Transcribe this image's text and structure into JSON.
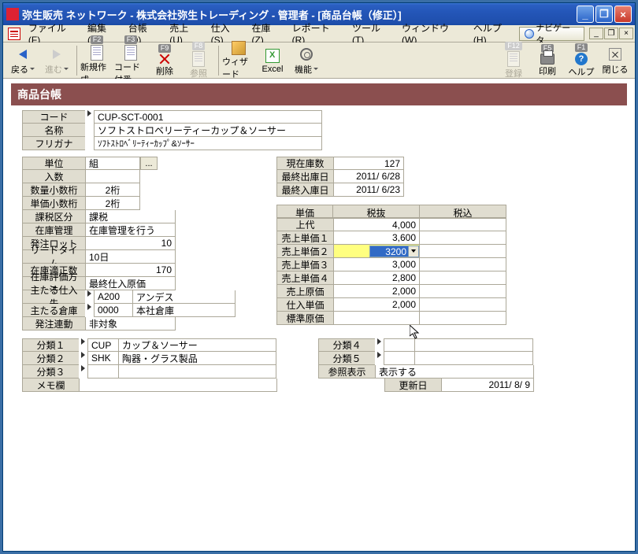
{
  "title": "弥生販売 ネットワーク - 株式会社弥生トレーディング - 管理者 - [商品台帳（修正）]",
  "nav_btn": "ナビゲータ",
  "menu": [
    "ファイル(F)",
    "編集(E)",
    "台帳(D)",
    "売上(U)",
    "仕入(S)",
    "在庫(Z)",
    "レポート(R)",
    "ツール(T)",
    "ウィンドウ(W)",
    "ヘルプ(H)"
  ],
  "tb": {
    "back": "戻る",
    "fwd": "進む",
    "new": "新規作成",
    "code": "コード付番",
    "del": "削除",
    "ref": "参照",
    "wiz": "ウィザード",
    "excel": "Excel",
    "func": "機能",
    "reg": "登録",
    "print": "印刷",
    "help": "ヘルプ",
    "close": "閉じる"
  },
  "header": "商品台帳",
  "main": {
    "code_l": "コード",
    "code_v": "CUP-SCT-0001",
    "name_l": "名称",
    "name_v": "ソフトストロベリーティーカップ＆ソーサー",
    "kana_l": "フリガナ",
    "kana_v": "ｿﾌﾄｽﾄﾛﾍﾞﾘｰﾃｨｰｶｯﾌﾟ&ｿｰｻｰ"
  },
  "left1": {
    "unit_l": "単位",
    "unit_v": "組",
    "qty_l": "入数",
    "qty_v": "",
    "dec1_l": "数量小数桁",
    "dec1_v": "2桁",
    "dec2_l": "単価小数桁",
    "dec2_v": "2桁",
    "tax_l": "課税区分",
    "tax_v": "課税",
    "stock_l": "在庫管理",
    "stock_v": "在庫管理を行う",
    "lot_l": "発注ロット",
    "lot_v": "10",
    "lead_l": "リードタイム",
    "lead_v": "10日",
    "prop_l": "在庫適正数",
    "prop_v": "170",
    "eval_l": "在庫評価方法",
    "eval_v": "最終仕入原価",
    "vend_l": "主たる仕入先",
    "vend_c": "A200",
    "vend_n": "アンデス",
    "wh_l": "主たる倉庫",
    "wh_c": "0000",
    "wh_n": "本社倉庫",
    "po_l": "発注連動",
    "po_v": "非対象"
  },
  "right1": {
    "curstock_l": "現在庫数",
    "curstock_v": "127",
    "lastout_l": "最終出庫日",
    "lastout_v": "2011/ 6/28",
    "lastin_l": "最終入庫日",
    "lastin_v": "2011/ 6/23"
  },
  "price": {
    "h_unit": "単価",
    "h_notax": "税抜",
    "h_tax": "税込",
    "rows": [
      {
        "l": "上代",
        "a": "4,000",
        "b": ""
      },
      {
        "l": "売上単価１",
        "a": "3,600",
        "b": ""
      },
      {
        "l": "売上単価２",
        "a": "3200",
        "b": "",
        "sel": true
      },
      {
        "l": "売上単価３",
        "a": "3,000",
        "b": ""
      },
      {
        "l": "売上単価４",
        "a": "2,800",
        "b": ""
      },
      {
        "l": "売上原価",
        "a": "2,000",
        "b": ""
      },
      {
        "l": "仕入単価",
        "a": "2,000",
        "b": ""
      },
      {
        "l": "標準原価",
        "a": "",
        "b": ""
      }
    ]
  },
  "bottom": {
    "c1_l": "分類１",
    "c1_c": "CUP",
    "c1_n": "カップ＆ソーサー",
    "c2_l": "分類２",
    "c2_c": "SHK",
    "c2_n": "陶器・グラス製品",
    "c3_l": "分類３",
    "memo_l": "メモ欄",
    "c4_l": "分類４",
    "c5_l": "分類５",
    "refdisp_l": "参照表示",
    "refdisp_v": "表示する",
    "upd_l": "更新日",
    "upd_v": "2011/ 8/ 9"
  }
}
